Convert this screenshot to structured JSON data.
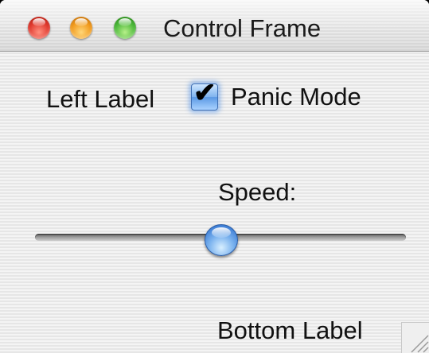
{
  "window": {
    "title": "Control Frame"
  },
  "controls": {
    "left_label": "Left Label",
    "checkbox": {
      "label": "Panic Mode",
      "checked": true,
      "check_glyph": "✔"
    },
    "speed_label": "Speed:",
    "slider": {
      "value": 50,
      "min": 0,
      "max": 100
    },
    "bottom_label": "Bottom Label"
  },
  "icons": {
    "close": "close-button-icon",
    "minimize": "minimize-button-icon",
    "zoom": "zoom-button-icon",
    "grow": "resize-grip-icon"
  },
  "colors": {
    "close": "#e0392e",
    "minimize": "#f19a1c",
    "zoom": "#4cb83a",
    "accent": "#5a98e4"
  }
}
